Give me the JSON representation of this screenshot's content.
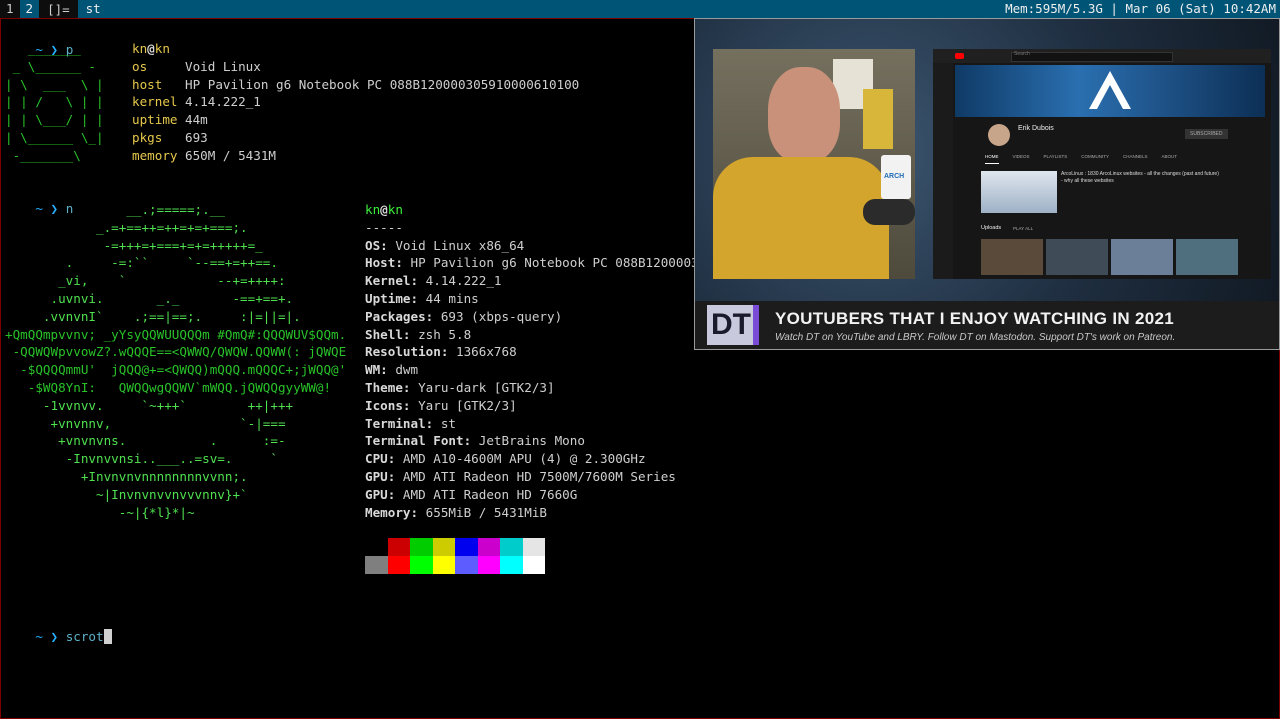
{
  "topbar": {
    "tags": [
      "1",
      "2"
    ],
    "active_tag": "2",
    "layout": "[]=",
    "window_title": "st",
    "status": "Mem:595M/5.3G | Mar 06 (Sat) 10:42AM"
  },
  "terminal": {
    "prompt": "~ ❯",
    "cmd1": "p",
    "cmd2": "n",
    "cmd3": "scrot",
    "p_art": [
      "   _______",
      " _ \\______ -",
      "| \\  ___  \\ |",
      "| | /   \\ | |",
      "| | \\___/ | |",
      "| \\______ \\_|",
      " -_______\\"
    ],
    "p_info": {
      "user": "kn",
      "host": "kn",
      "rows": [
        {
          "key": "os",
          "val": "Void Linux"
        },
        {
          "key": "host",
          "val": "HP Pavilion g6 Notebook PC 088B120000305910000610100"
        },
        {
          "key": "kernel",
          "val": "4.14.222_1"
        },
        {
          "key": "uptime",
          "val": "44m"
        },
        {
          "key": "pkgs",
          "val": "693"
        },
        {
          "key": "memory",
          "val": "650M / 5431M"
        }
      ]
    },
    "n_art": [
      "                __.;=====;.__",
      "            _.=+==++=++=+=+===;.",
      "             -=+++=+===+=+=+++++=_",
      "        .     -=:``     `--==+=++==.",
      "       _vi,    `            --+=++++:",
      "      .uvnvi.       _._       -==+==+.",
      "     .vvnvnI`    .;==|==;.     :|=||=|.",
      "+QmQQmpvvnv; _yYsyQQWUUQQQm #QmQ#:QQQWUV$QQm.",
      " -QQWQWpvvowZ?.wQQQE==<QWWQ/QWQW.QQWW(: jQWQE",
      "  -$QQQQmmU'  jQQQ@+=<QWQQ)mQQQ.mQQQC+;jWQQ@'",
      "   -$WQ8YnI:   QWQQwgQQWV`mWQQ.jQWQQgyyWW@!",
      "     -1vvnvv.     `~+++`        ++|+++",
      "      +vnvnnv,                 `-|===",
      "       +vnvnvns.           .      :=-",
      "        -Invnvvnsi..___..=sv=.     `",
      "          +Invnvnvnnnnnnnnvvnn;.",
      "            ~|Invnvnvvnvvvnnv}+`",
      "               -~|{*l}*|~"
    ],
    "n_info": {
      "user": "kn",
      "host": "kn",
      "sep": "-----",
      "rows": [
        {
          "key": "OS",
          "val": "Void Linux x86_64"
        },
        {
          "key": "Host",
          "val": "HP Pavilion g6 Notebook PC 088B1200003"
        },
        {
          "key": "Kernel",
          "val": "4.14.222_1"
        },
        {
          "key": "Uptime",
          "val": "44 mins"
        },
        {
          "key": "Packages",
          "val": "693 (xbps-query)"
        },
        {
          "key": "Shell",
          "val": "zsh 5.8"
        },
        {
          "key": "Resolution",
          "val": "1366x768"
        },
        {
          "key": "WM",
          "val": "dwm"
        },
        {
          "key": "Theme",
          "val": "Yaru-dark [GTK2/3]"
        },
        {
          "key": "Icons",
          "val": "Yaru [GTK2/3]"
        },
        {
          "key": "Terminal",
          "val": "st"
        },
        {
          "key": "Terminal Font",
          "val": "JetBrains Mono"
        },
        {
          "key": "CPU",
          "val": "AMD A10-4600M APU (4) @ 2.300GHz"
        },
        {
          "key": "GPU",
          "val": "AMD ATI Radeon HD 7500M/7600M Series"
        },
        {
          "key": "GPU",
          "val": "AMD ATI Radeon HD 7660G"
        },
        {
          "key": "Memory",
          "val": "655MiB / 5431MiB"
        }
      ]
    },
    "palette_top": [
      "#000000",
      "#cc0000",
      "#00cc00",
      "#cccc00",
      "#0000ee",
      "#cc00cc",
      "#00cccc",
      "#e5e5e5"
    ],
    "palette_bottom": [
      "#7f7f7f",
      "#ff0000",
      "#00ff00",
      "#ffff00",
      "#5c5cff",
      "#ff00ff",
      "#00ffff",
      "#ffffff"
    ]
  },
  "video": {
    "banner_logo": "DT",
    "banner_title": "YOUTUBERS THAT I ENJOY WATCHING IN 2021",
    "banner_subtitle": "Watch DT on YouTube and LBRY.  Follow DT on Mastodon.  Support DT's work on Patreon.",
    "yt": {
      "search_placeholder": "Search",
      "channel_name": "Erik Dubois",
      "subscribe": "SUBSCRIBED",
      "tabs": [
        "HOME",
        "VIDEOS",
        "PLAYLISTS",
        "COMMUNITY",
        "CHANNELS",
        "ABOUT"
      ],
      "featured_title": "ArcoLinux : 1830 ArcoLinux websites - all the changes (past and future) - why all these websites",
      "uploads_label": "Uploads",
      "play_all": "PLAY ALL",
      "mug_text": "ARCH"
    }
  }
}
